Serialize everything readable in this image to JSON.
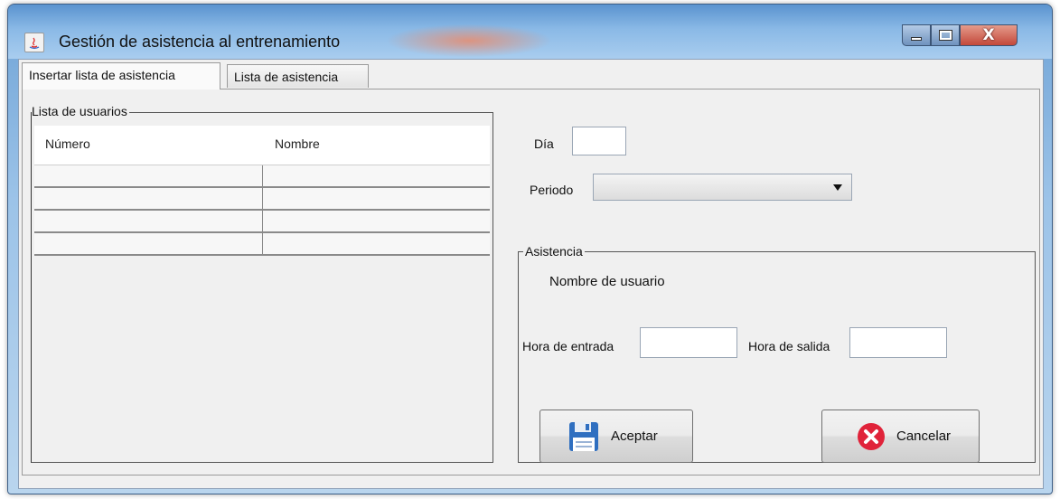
{
  "window": {
    "title": "Gestión de asistencia al entrenamiento",
    "controls": {
      "minimize": "minimize",
      "maximize": "maximize",
      "close": "x"
    }
  },
  "tabs": [
    {
      "label": "Insertar lista de asistencia",
      "selected": true
    },
    {
      "label": "Lista de asistencia",
      "selected": false
    }
  ],
  "users_group": {
    "title": "Lista de usuarios",
    "columns": [
      "Número",
      "Nombre"
    ],
    "rows": [
      [
        "",
        ""
      ],
      [
        "",
        ""
      ],
      [
        "",
        ""
      ],
      [
        "",
        ""
      ]
    ]
  },
  "form": {
    "dia_label": "Día",
    "dia_value": "",
    "periodo_label": "Periodo",
    "periodo_value": ""
  },
  "asistencia_group": {
    "title": "Asistencia",
    "user_name_label": "Nombre de usuario",
    "entrada_label": "Hora de entrada",
    "entrada_value": "",
    "salida_label": "Hora de salida",
    "salida_value": "",
    "accept_label": "Aceptar",
    "cancel_label": "Cancelar"
  },
  "colors": {
    "titlebar": "#8ab9e6",
    "client_bg": "#f0f0f0",
    "cancel_icon": "#e0233a",
    "save_icon": "#2f6fc0"
  }
}
